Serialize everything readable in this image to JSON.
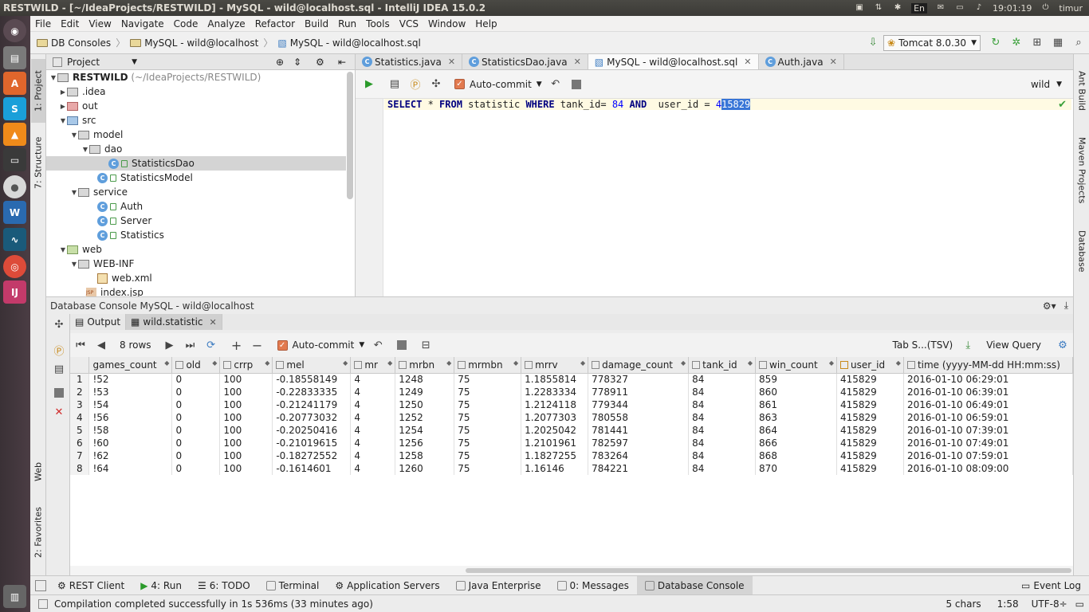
{
  "os": {
    "window_title": "RESTWILD - [~/IdeaProjects/RESTWILD] - MySQL - wild@localhost.sql - IntelliJ IDEA 15.0.2",
    "keyboard_layout": "En",
    "clock": "19:01:19",
    "user": "timur"
  },
  "menu": [
    "File",
    "Edit",
    "View",
    "Navigate",
    "Code",
    "Analyze",
    "Refactor",
    "Build",
    "Run",
    "Tools",
    "VCS",
    "Window",
    "Help"
  ],
  "breadcrumbs": [
    "DB Consoles",
    "MySQL - wild@localhost",
    "MySQL - wild@localhost.sql"
  ],
  "run_config": "Tomcat 8.0.30",
  "left_tool_tabs": [
    "1: Project",
    "7: Structure",
    "Web",
    "2: Favorites"
  ],
  "right_tool_tabs": [
    "Ant Build",
    "Maven Projects",
    "Database"
  ],
  "project": {
    "header": "Project",
    "root_name": "RESTWILD",
    "root_path": "(~/IdeaProjects/RESTWILD)",
    "nodes": [
      ".idea",
      "out",
      "src",
      "model",
      "dao",
      "StatisticsDao",
      "StatisticsModel",
      "service",
      "Auth",
      "Server",
      "Statistics",
      "web",
      "WEB-INF",
      "web.xml",
      "index.jsp"
    ]
  },
  "editor_tabs": [
    {
      "label": "Statistics.java",
      "active": false
    },
    {
      "label": "StatisticsDao.java",
      "active": false
    },
    {
      "label": "MySQL - wild@localhost.sql",
      "active": true
    },
    {
      "label": "Auth.java",
      "active": false
    }
  ],
  "editor_toolbar": {
    "auto_commit": "Auto-commit",
    "schema": "wild"
  },
  "sql": {
    "select": "SELECT",
    "star": " * ",
    "from": "FROM",
    "table": " statistic ",
    "where": "WHERE",
    "col1": " tank_id= ",
    "val1": "84",
    "and": " AND ",
    "col2": " user_id = ",
    "val2a": "4",
    "val2b": "15829"
  },
  "console": {
    "title": "Database Console MySQL - wild@localhost",
    "tabs": [
      "Output",
      "wild.statistic"
    ],
    "rows_label": "8 rows",
    "auto_commit": "Auto-commit",
    "format": "Tab S...(TSV)",
    "view_query": "View Query"
  },
  "grid": {
    "columns": [
      "games_count",
      "old",
      "crrp",
      "mel",
      "mr",
      "mrbn",
      "mrmbn",
      "mrrv",
      "damage_count",
      "tank_id",
      "win_count",
      "user_id",
      "time (yyyy-MM-dd HH:mm:ss)"
    ],
    "rows": [
      [
        "1",
        "!52",
        "0",
        "100",
        "-0.18558149",
        "4",
        "1248",
        "75",
        "1.1855814",
        "778327",
        "84",
        "859",
        "415829",
        "2016-01-10 06:29:01"
      ],
      [
        "2",
        "!53",
        "0",
        "100",
        "-0.22833335",
        "4",
        "1249",
        "75",
        "1.2283334",
        "778911",
        "84",
        "860",
        "415829",
        "2016-01-10 06:39:01"
      ],
      [
        "3",
        "!54",
        "0",
        "100",
        "-0.21241179",
        "4",
        "1250",
        "75",
        "1.2124118",
        "779344",
        "84",
        "861",
        "415829",
        "2016-01-10 06:49:01"
      ],
      [
        "4",
        "!56",
        "0",
        "100",
        "-0.20773032",
        "4",
        "1252",
        "75",
        "1.2077303",
        "780558",
        "84",
        "863",
        "415829",
        "2016-01-10 06:59:01"
      ],
      [
        "5",
        "!58",
        "0",
        "100",
        "-0.20250416",
        "4",
        "1254",
        "75",
        "1.2025042",
        "781441",
        "84",
        "864",
        "415829",
        "2016-01-10 07:39:01"
      ],
      [
        "6",
        "!60",
        "0",
        "100",
        "-0.21019615",
        "4",
        "1256",
        "75",
        "1.2101961",
        "782597",
        "84",
        "866",
        "415829",
        "2016-01-10 07:49:01"
      ],
      [
        "7",
        "!62",
        "0",
        "100",
        "-0.18272552",
        "4",
        "1258",
        "75",
        "1.1827255",
        "783264",
        "84",
        "868",
        "415829",
        "2016-01-10 07:59:01"
      ],
      [
        "8",
        "!64",
        "0",
        "100",
        "-0.1614601",
        "4",
        "1260",
        "75",
        "1.16146",
        "784221",
        "84",
        "870",
        "415829",
        "2016-01-10 08:09:00"
      ]
    ]
  },
  "bottom_tabs": [
    "REST Client",
    "4: Run",
    "6: TODO",
    "Terminal",
    "Application Servers",
    "Java Enterprise",
    "0: Messages",
    "Database Console"
  ],
  "event_log": "Event Log",
  "status": {
    "message": "Compilation completed successfully in 1s 536ms (33 minutes ago)",
    "chars": "5 chars",
    "position": "1:58",
    "encoding": "UTF-8÷"
  }
}
